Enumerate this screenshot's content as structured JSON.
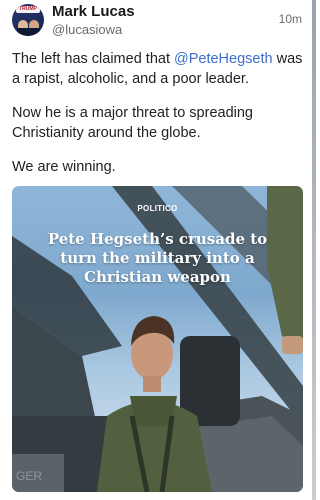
{
  "post": {
    "author_name": "Mark Lucas",
    "author_handle": "@lucasiowa",
    "time_ago": "10m",
    "avatar_badge": "TRUMP",
    "para1_before": "The left has claimed that ",
    "mention": "@PeteHegseth",
    "para1_after": " was a rapist, alcoholic, and a poor leader.",
    "para2": "Now he is a major threat to spreading Christianity around the globe.",
    "para3": "We are winning."
  },
  "media": {
    "source": "POLITICO",
    "headline": "Pete Hegseth’s crusade to turn the military into a Christian weapon",
    "jet_marking": "GER"
  },
  "colors": {
    "mention": "#3d6ec9",
    "muted": "#6b6b6b"
  }
}
